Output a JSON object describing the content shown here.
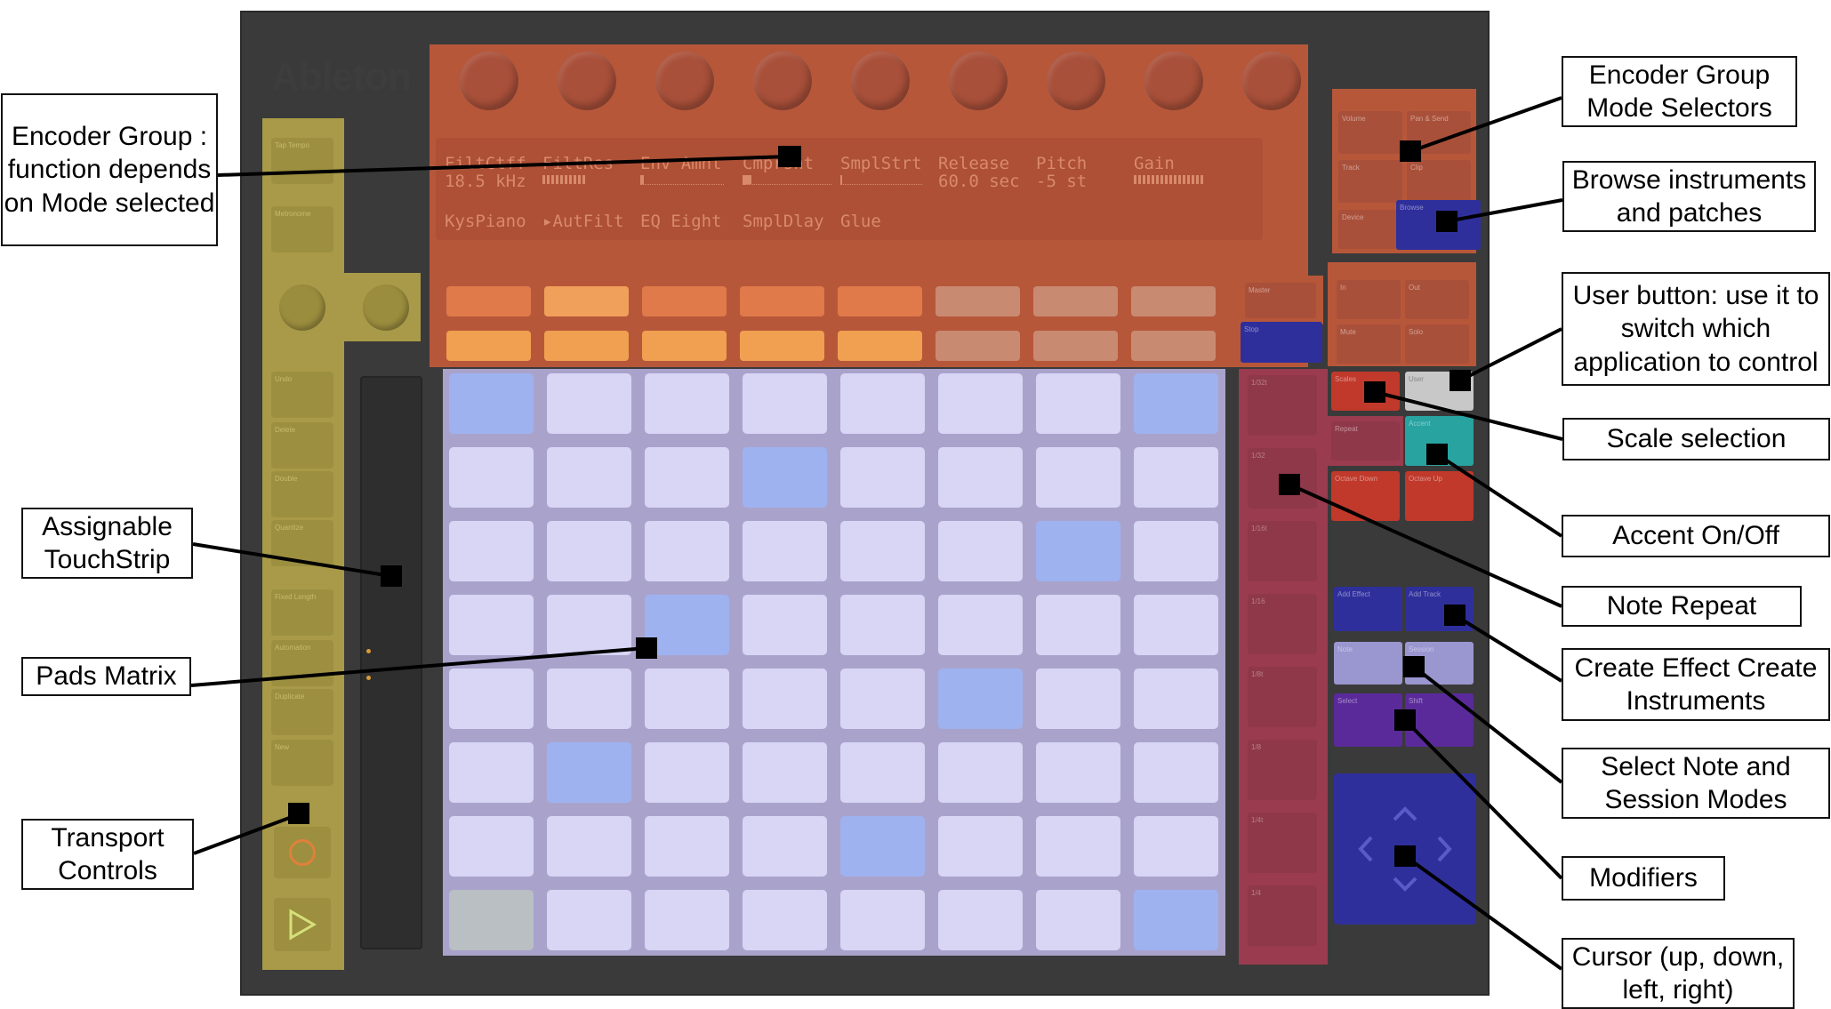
{
  "logo": "Ableton",
  "display": {
    "row1": [
      "FiltCtff",
      "FiltRes",
      "Env Amnt",
      "Cmprsnt",
      "SmplStrt",
      "Release",
      "Pitch",
      "Gain"
    ],
    "row2": [
      "18.5 kHz",
      "",
      "",
      "",
      "",
      "60.0 sec",
      "-5 st",
      ""
    ],
    "row3": [
      "KysPiano",
      "▸AutFilt",
      "EQ Eight",
      "SmplDlay",
      "Glue"
    ]
  },
  "side_buttons": [
    "Tap Tempo",
    "Metronome",
    "Undo",
    "Delete",
    "Double",
    "Quantize",
    "Fixed Length",
    "Automation",
    "Duplicate",
    "New"
  ],
  "right_buttons": {
    "volume": "Volume",
    "pan_send": "Pan & Send",
    "track": "Track",
    "clip": "Clip",
    "device": "Device",
    "browse": "Browse",
    "master": "Master",
    "stop": "Stop",
    "in": "In",
    "out": "Out",
    "mute": "Mute",
    "solo": "Solo",
    "scales": "Scales",
    "user": "User",
    "repeat": "Repeat",
    "accent": "Accent",
    "octave_down": "Octave Down",
    "octave_up": "Octave Up",
    "add_effect": "Add Effect",
    "add_track": "Add Track",
    "note": "Note",
    "session": "Session",
    "select": "Select",
    "shift": "Shift"
  },
  "scene_labels": [
    "1/32t",
    "1/32",
    "1/16t",
    "1/16",
    "1/8t",
    "1/8",
    "1/4t",
    "1/4"
  ],
  "pads": {
    "blue_positions": [
      "0-0",
      "0-7",
      "1-3",
      "2-6",
      "3-2",
      "4-5",
      "5-1",
      "6-4",
      "7-7"
    ],
    "grey_positions": [
      "7-0"
    ]
  },
  "colors": {
    "encoder_group": "#b7573a",
    "transport": "#a89a48",
    "pads": "#a9a3cc",
    "scenes": "#9a3b4f",
    "blue": "#2f2f9c",
    "red": "#c0392b",
    "teal": "#28a3a0",
    "purple": "#5a2a9a",
    "lavender": "#9a96d0"
  },
  "callouts": {
    "encoder_group": "Encoder Group : function depends on Mode selected",
    "touchstrip": "Assignable TouchStrip",
    "pads_matrix": "Pads Matrix",
    "transport": "Transport Controls",
    "mode_selectors": "Encoder Group Mode Selectors",
    "browse": "Browse instruments and patches",
    "user": "User button: use it to switch which application to control",
    "scale": "Scale selection",
    "accent": "Accent On/Off",
    "note_repeat": "Note Repeat",
    "create": "Create Effect Create Instruments",
    "select_modes": "Select Note and Session Modes",
    "modifiers": "Modifiers",
    "cursor": "Cursor (up, down, left, right)"
  }
}
